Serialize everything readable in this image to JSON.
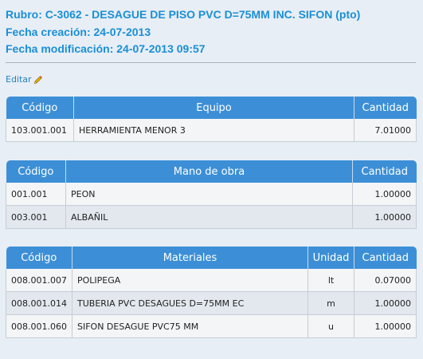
{
  "header": {
    "rubro": "Rubro: C-3062 - DESAGUE DE PISO PVC D=75MM INC. SIFON (pto)",
    "fecha_creacion": "Fecha creación: 24-07-2013",
    "fecha_modificacion": "Fecha modificación: 24-07-2013 09:57"
  },
  "edit_label": "Editar",
  "equipo": {
    "columns": [
      "Código",
      "Equipo",
      "Cantidad"
    ],
    "rows": [
      {
        "codigo": "103.001.001",
        "nombre": "HERRAMIENTA MENOR 3",
        "cantidad": "7.01000"
      }
    ]
  },
  "mano_obra": {
    "columns": [
      "Código",
      "Mano de obra",
      "Cantidad"
    ],
    "rows": [
      {
        "codigo": "001.001",
        "nombre": "PEON",
        "cantidad": "1.00000"
      },
      {
        "codigo": "003.001",
        "nombre": "ALBAÑIL",
        "cantidad": "1.00000"
      }
    ]
  },
  "materiales": {
    "columns": [
      "Código",
      "Materiales",
      "Unidad",
      "Cantidad"
    ],
    "rows": [
      {
        "codigo": "008.001.007",
        "nombre": "POLIPEGA",
        "unidad": "lt",
        "cantidad": "0.07000"
      },
      {
        "codigo": "008.001.014",
        "nombre": "TUBERIA PVC DESAGUES D=75MM EC",
        "unidad": "m",
        "cantidad": "1.00000"
      },
      {
        "codigo": "008.001.060",
        "nombre": "SIFON DESAGUE PVC75 MM",
        "unidad": "u",
        "cantidad": "1.00000"
      }
    ]
  },
  "icons": {
    "edit": "pencil-icon"
  },
  "colors": {
    "accent": "#1a8fd6",
    "table_header": "#3c8fd6"
  }
}
